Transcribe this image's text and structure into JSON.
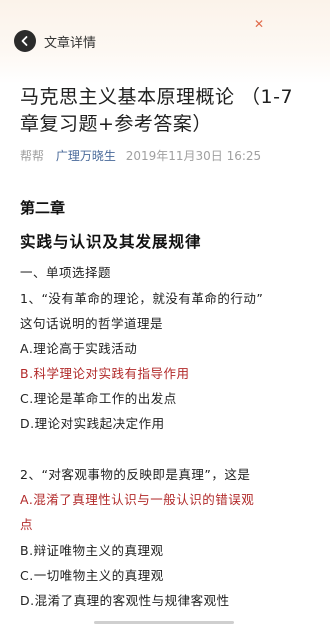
{
  "nav": {
    "title": "文章详情"
  },
  "article": {
    "title_line1": "马克思主义基本原理概论 （1-7",
    "title_line2": "章复习题+参考答案）",
    "source": "帮帮",
    "author": "广理万晓生",
    "date": "2019年11月30日 16:25"
  },
  "content": {
    "chapter": "第二章",
    "chapter_title": "实践与认识及其发展规律",
    "section": "一、单项选择题",
    "q1_line1": "1、“没有革命的理论，就没有革命的行动”",
    "q1_line2": "这句话说明的哲学道理是",
    "q1_a": "A.理论高于实践活动",
    "q1_b": "B.科学理论对实践有指导作用",
    "q1_c": "C.理论是革命工作的出发点",
    "q1_d": "D.理论对实践起决定作用",
    "q2_line1": "2、“对客观事物的反映即是真理”，这是",
    "q2_a_line1": "A.混淆了真理性认识与一般认识的错误观",
    "q2_a_line2": "点",
    "q2_b": "B.辩证唯物主义的真理观",
    "q2_c": "C.一切唯物主义的真理观",
    "q2_d": "D.混淆了真理的客观性与规律客观性"
  },
  "colors": {
    "answer": "#b22a2a",
    "author": "#4a6a9a",
    "meta": "#a0a0a0"
  }
}
